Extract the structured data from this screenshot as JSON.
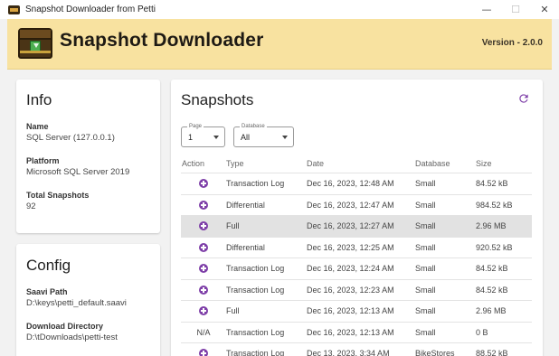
{
  "window": {
    "title": "Snapshot Downloader from Petti",
    "minimize_glyph": "—",
    "maximize_glyph": "☐",
    "close_glyph": "✕"
  },
  "header": {
    "app_name": "Snapshot Downloader",
    "version": "Version - 2.0.0",
    "logo_icon": "treasure-chest-download-icon",
    "background_color": "#f8e2a0"
  },
  "info": {
    "title": "Info",
    "name_label": "Name",
    "name_value": "SQL Server (127.0.0.1)",
    "platform_label": "Platform",
    "platform_value": "Microsoft SQL Server 2019",
    "total_label": "Total Snapshots",
    "total_value": "92"
  },
  "config": {
    "title": "Config",
    "saavi_label": "Saavi Path",
    "saavi_value": "D:\\keys\\petti_default.saavi",
    "download_label": "Download Directory",
    "download_value": "D:\\tDownloads\\petti-test"
  },
  "snapshots": {
    "title": "Snapshots",
    "refresh_icon": "refresh-icon",
    "accent_color": "#7e3fa8",
    "page_select": {
      "label": "Page",
      "value": "1"
    },
    "database_select": {
      "label": "Database",
      "value": "All"
    },
    "columns": {
      "action": "Action",
      "type": "Type",
      "date": "Date",
      "database": "Database",
      "size": "Size"
    },
    "rows": [
      {
        "action": "download",
        "type": "Transaction Log",
        "date": "Dec 16, 2023, 12:48 AM",
        "database": "Small",
        "size": "84.52 kB"
      },
      {
        "action": "download",
        "type": "Differential",
        "date": "Dec 16, 2023, 12:47 AM",
        "database": "Small",
        "size": "984.52 kB"
      },
      {
        "action": "download",
        "type": "Full",
        "date": "Dec 16, 2023, 12:27 AM",
        "database": "Small",
        "size": "2.96 MB"
      },
      {
        "action": "download",
        "type": "Differential",
        "date": "Dec 16, 2023, 12:25 AM",
        "database": "Small",
        "size": "920.52 kB"
      },
      {
        "action": "download",
        "type": "Transaction Log",
        "date": "Dec 16, 2023, 12:24 AM",
        "database": "Small",
        "size": "84.52 kB"
      },
      {
        "action": "download",
        "type": "Transaction Log",
        "date": "Dec 16, 2023, 12:23 AM",
        "database": "Small",
        "size": "84.52 kB"
      },
      {
        "action": "download",
        "type": "Full",
        "date": "Dec 16, 2023, 12:13 AM",
        "database": "Small",
        "size": "2.96 MB"
      },
      {
        "action": "N/A",
        "type": "Transaction Log",
        "date": "Dec 16, 2023, 12:13 AM",
        "database": "Small",
        "size": "0 B"
      },
      {
        "action": "download",
        "type": "Transaction Log",
        "date": "Dec 13, 2023, 3:34 AM",
        "database": "BikeStores",
        "size": "88.52 kB"
      }
    ]
  }
}
